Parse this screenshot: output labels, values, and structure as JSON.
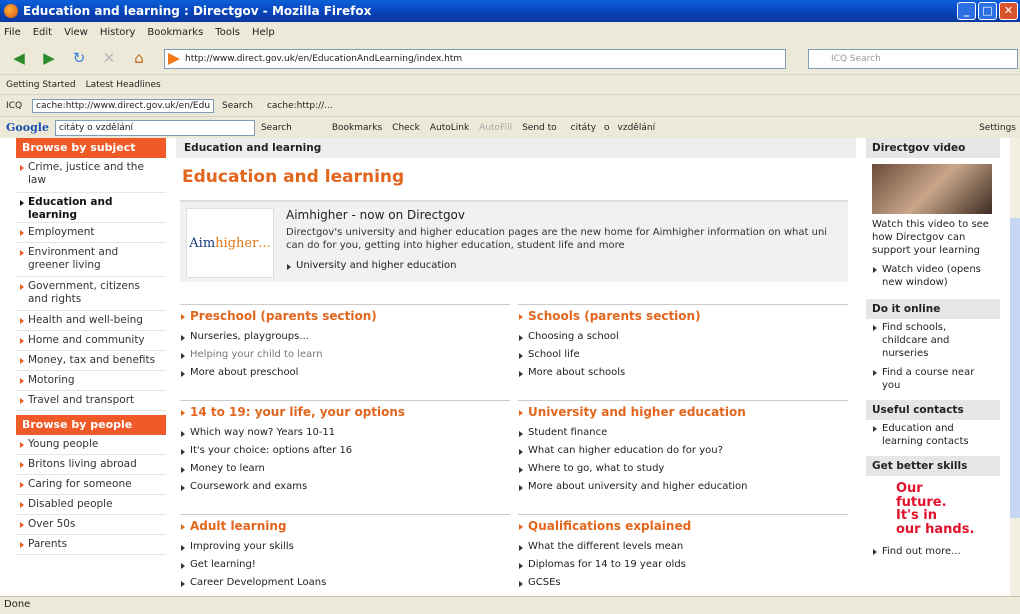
{
  "window": {
    "title": "Education and learning : Directgov - Mozilla Firefox"
  },
  "menu": [
    "File",
    "Edit",
    "View",
    "History",
    "Bookmarks",
    "Tools",
    "Help"
  ],
  "address": {
    "url": "http://www.direct.gov.uk/en/EducationAndLearning/index.htm",
    "search_placeholder": "ICQ Search"
  },
  "bookmarks": [
    "Getting Started",
    "Latest Headlines"
  ],
  "icq_bar": {
    "label": "ICQ",
    "cache_field": "cache:http://www.direct.gov.uk/en/Edu",
    "search_label": "Search",
    "cache_text": "cache:http://..."
  },
  "google_bar": {
    "logo": "Google",
    "query": "citáty o vzdělání",
    "search": "Search",
    "bookmarks": "Bookmarks",
    "check": "Check",
    "autolink": "AutoLink",
    "autofill": "AutoFill",
    "send_to": "Send to",
    "q1": "citáty",
    "q2": "o",
    "q3": "vzdělání",
    "settings": "Settings"
  },
  "sidebar": {
    "subject_head": "Browse by subject",
    "subjects": [
      {
        "label": "Crime, justice and the law"
      },
      {
        "label": "Education and learning"
      },
      {
        "label": "Employment"
      },
      {
        "label": "Environment and greener living"
      },
      {
        "label": "Government, citizens and rights"
      },
      {
        "label": "Health and well-being"
      },
      {
        "label": "Home and community"
      },
      {
        "label": "Money, tax and benefits"
      },
      {
        "label": "Motoring"
      },
      {
        "label": "Travel and transport"
      }
    ],
    "people_head": "Browse by people",
    "people": [
      {
        "label": "Young people"
      },
      {
        "label": "Britons living abroad"
      },
      {
        "label": "Caring for someone"
      },
      {
        "label": "Disabled people"
      },
      {
        "label": "Over 50s"
      },
      {
        "label": "Parents"
      }
    ]
  },
  "main": {
    "breadcrumb": "Education and learning",
    "title": "Education and learning",
    "promo": {
      "logo_a": "Aim",
      "logo_b": "higher",
      "logo_dots": "...",
      "title": "Aimhigher - now on Directgov",
      "text": "Directgov's university and higher education pages are the new home for Aimhigher information on what uni can do for you, getting into higher education, student life and more",
      "link": "University and higher education"
    },
    "sections": [
      {
        "title": "Preschool (parents section)",
        "items": [
          "Nurseries, playgroups...",
          "Helping your child to learn",
          "More about preschool"
        ]
      },
      {
        "title": "Schools (parents section)",
        "items": [
          "Choosing a school",
          "School life",
          "More about schools"
        ]
      },
      {
        "title": "14 to 19: your life, your options",
        "items": [
          "Which way now? Years 10-11",
          "It's your choice: options after 16",
          "Money to learn",
          "Coursework and exams"
        ]
      },
      {
        "title": "University and higher education",
        "items": [
          "Student finance",
          "What can higher education do for you?",
          "Where to go, what to study",
          "More about university and higher education"
        ]
      },
      {
        "title": "Adult learning",
        "items": [
          "Improving your skills",
          "Get learning!",
          "Career Development Loans"
        ]
      },
      {
        "title": "Qualifications explained",
        "items": [
          "What the different levels mean",
          "Diplomas for 14 to 19 year olds",
          "GCSEs"
        ]
      }
    ]
  },
  "right": {
    "video_head": "Directgov video",
    "video_text": "Watch this video to see how Directgov can support your learning",
    "video_link": "Watch video (opens new window)",
    "online_head": "Do it online",
    "online_links": [
      "Find schools, childcare and nurseries",
      "Find a course near you"
    ],
    "contacts_head": "Useful contacts",
    "contacts_link": "Education and learning contacts",
    "skills_head": "Get better skills",
    "skills_l1": "Our",
    "skills_l2": "future.",
    "skills_l3": "It's in",
    "skills_l4": "our hands.",
    "skills_link": "Find out more..."
  },
  "status": "Done"
}
